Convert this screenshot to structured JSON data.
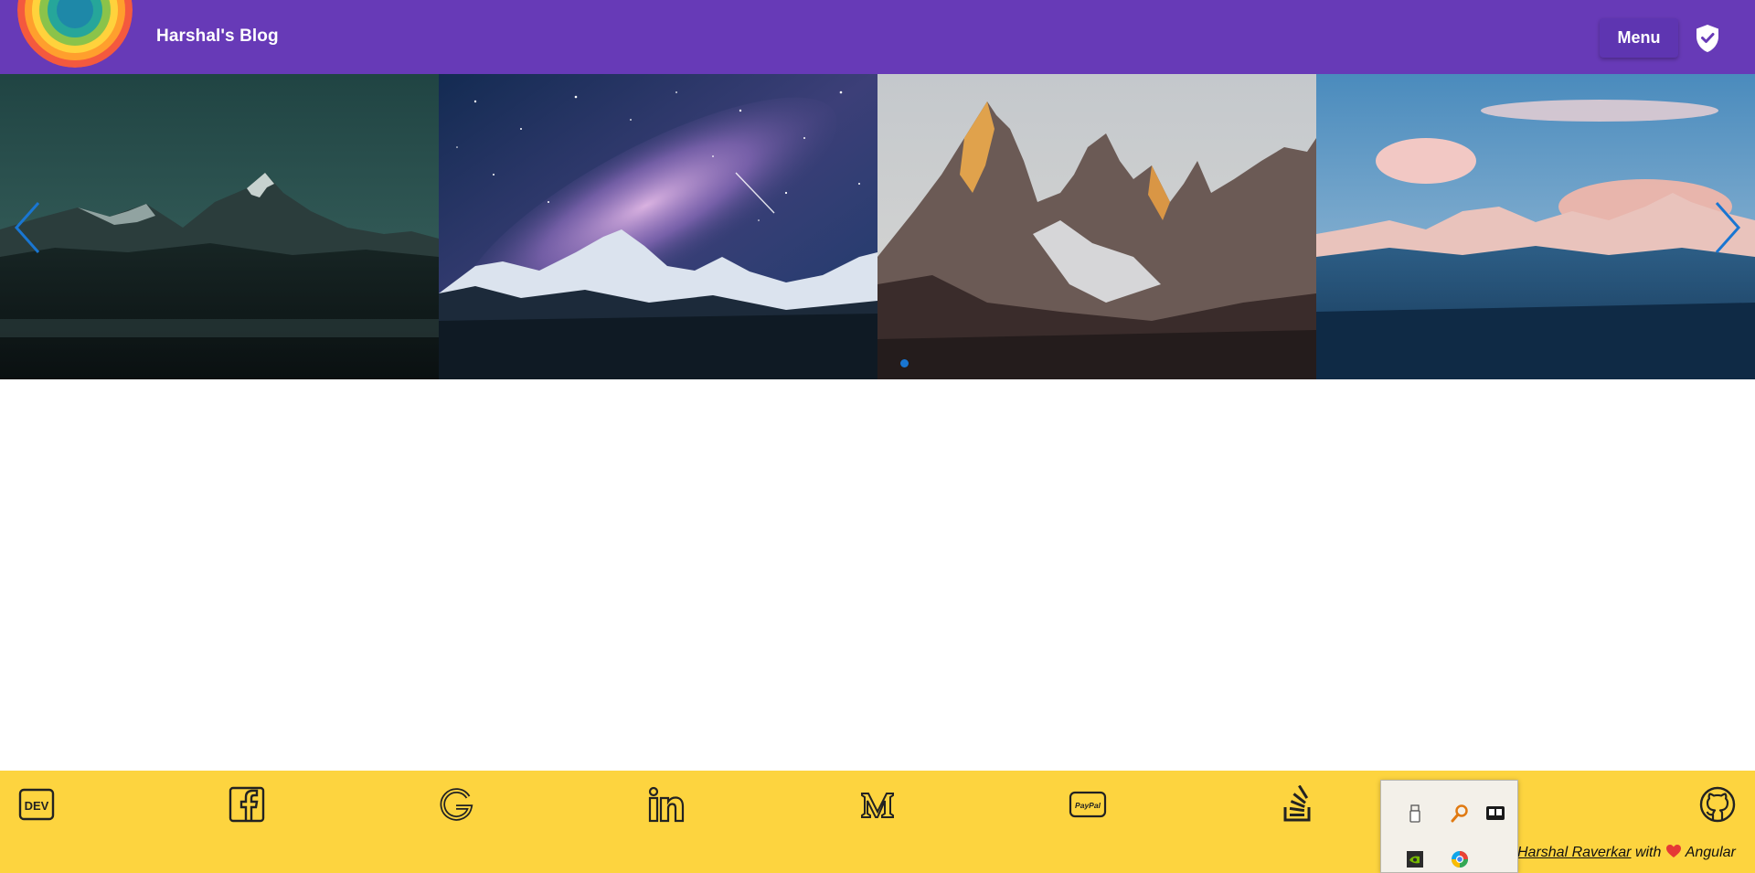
{
  "header": {
    "brand_title": "Harshal's Blog",
    "menu_label": "Menu"
  },
  "carousel": {
    "slides": [
      {
        "icon": "mountain-night-photo"
      },
      {
        "icon": "milky-way-mountain-photo"
      },
      {
        "icon": "granite-peaks-photo"
      },
      {
        "icon": "pink-snow-peaks-photo"
      }
    ],
    "indicator_count": 1,
    "active_index": 0
  },
  "footer": {
    "social_links": [
      {
        "icon": "dev-icon"
      },
      {
        "icon": "facebook-icon"
      },
      {
        "icon": "google-icon"
      },
      {
        "icon": "linkedin-icon"
      },
      {
        "icon": "medium-icon"
      },
      {
        "icon": "paypal-icon"
      },
      {
        "icon": "stackoverflow-icon"
      },
      {
        "icon": "github-icon"
      }
    ],
    "credit": {
      "author": "Harshal Raverkar",
      "with": "with",
      "framework": "Angular"
    }
  },
  "tray_popup": {
    "icons": [
      "usb-drive-icon",
      "magnifier-icon",
      "display-app-icon",
      "nvidia-icon",
      "browser-color-icon"
    ]
  },
  "colors": {
    "header_bg": "#673ab7",
    "menu_button_bg": "#5e35b1",
    "footer_bg": "#fdd43f",
    "carousel_accent": "#1976d2",
    "heart": "#e53935"
  }
}
